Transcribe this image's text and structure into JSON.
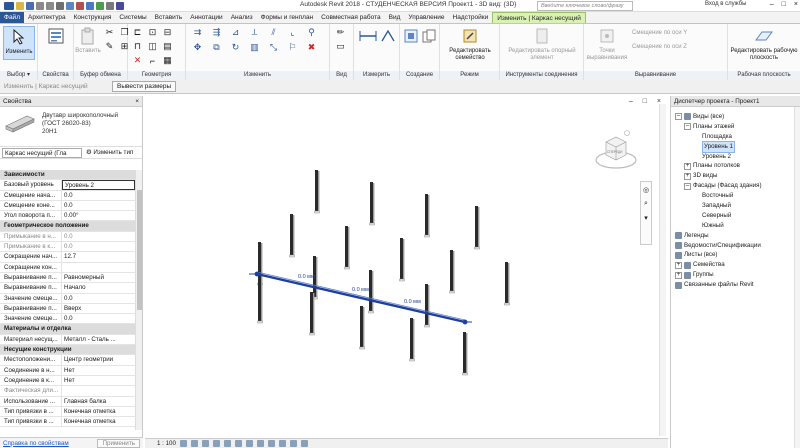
{
  "window": {
    "title": "Autodesk Revit 2018 - СТУДЕНЧЕСКАЯ ВЕРСИЯ    Проект1 - 3D вид: {3D}",
    "search_placeholder": "Введите ключевое слово/фразу",
    "login": "Вход в службы",
    "controls": [
      "–",
      "□",
      "×"
    ]
  },
  "tabs": [
    "Файл",
    "Архитектура",
    "Конструкция",
    "Системы",
    "Вставить",
    "Аннотации",
    "Анализ",
    "Формы и генплан",
    "Совместная работа",
    "Вид",
    "Управление",
    "Надстройки",
    "Изменить | Каркас несущий"
  ],
  "ribbon": {
    "select": {
      "modify": "Изменить",
      "label": "Выбор ▾"
    },
    "properties": {
      "label": "Свойства"
    },
    "clipboard": {
      "paste": "Вставить",
      "label": "Буфер обмена"
    },
    "geometry": {
      "label": "Геометрия"
    },
    "modify": {
      "label": "Изменить"
    },
    "view": {
      "label": "Вид"
    },
    "measure": {
      "label": "Измерить"
    },
    "create": {
      "label": "Создание"
    },
    "mode": {
      "edit_family": "Редактировать семейство",
      "label": "Режим"
    },
    "connection_tools": {
      "edit_element": "Редактировать опорный элемент",
      "label": "Инструменты соединения"
    },
    "justification": {
      "points": "Точки выравнивания",
      "y_offset": "Смещение по оси Y",
      "z_offset": "Смещение по оси Z",
      "label": "Выравнивание"
    },
    "workplane": {
      "edit": "Редактировать рабочую плоскость",
      "label": "Рабочая плоскость"
    }
  },
  "options_bar": {
    "context": "Изменить | Каркас несущий",
    "button": "Вывести размеры"
  },
  "properties": {
    "title": "Свойства",
    "type_name": [
      "Двутавр широкополочный",
      "(ГОСТ 26020-83)",
      "20Н1"
    ],
    "instance_filter": "Каркас несущий (Гла",
    "edit_type": "Изменить тип",
    "rows": [
      {
        "k": "Зависимости",
        "v": "",
        "group": true
      },
      {
        "k": "Базовый уровень",
        "v": "Уровень 2",
        "sel": true
      },
      {
        "k": "Смещение нача...",
        "v": "0.0"
      },
      {
        "k": "Смещение коне...",
        "v": "0.0"
      },
      {
        "k": "Угол поворота п...",
        "v": "0.00°"
      },
      {
        "k": "Геометрическое положение",
        "v": "",
        "group": true
      },
      {
        "k": "Примыкание в н...",
        "v": "0.0",
        "dim": true
      },
      {
        "k": "Примыкание в к...",
        "v": "0.0",
        "dim": true
      },
      {
        "k": "Сокращение нач...",
        "v": "12.7"
      },
      {
        "k": "Сокращение кон...",
        "v": ""
      },
      {
        "k": "Выравнивание п...",
        "v": "Равномерный"
      },
      {
        "k": "Выравнивание п...",
        "v": "Начало"
      },
      {
        "k": "Значение смеще...",
        "v": "0.0"
      },
      {
        "k": "Выравнивание п...",
        "v": "Вверх"
      },
      {
        "k": "Значение смеще...",
        "v": "0.0"
      },
      {
        "k": "Материалы и отделка",
        "v": "",
        "group": true
      },
      {
        "k": "Материал несущ...",
        "v": "Металл - Сталь ..."
      },
      {
        "k": "Несущие конструкции",
        "v": "",
        "group": true
      },
      {
        "k": "Местоположени...",
        "v": "Центр геометрии"
      },
      {
        "k": "Соединение в н...",
        "v": "Нет"
      },
      {
        "k": "Соединение в к...",
        "v": "Нет"
      },
      {
        "k": "Фактическая дли...",
        "v": "",
        "dim": true
      },
      {
        "k": "Использование ...",
        "v": "Главная балка"
      },
      {
        "k": "Тип привязки в ...",
        "v": "Конечная отметка"
      },
      {
        "k": "Тип привязки в ...",
        "v": "Конечная отметка"
      }
    ],
    "help_link": "Справка по свойствам",
    "apply": "Применить"
  },
  "viewport": {
    "dimensions": [
      "0.0 мм",
      "0.0 мм",
      "0.0 мм"
    ],
    "viewcube_front": "СПЕРЕДИ",
    "view_controls": "–  □  ×"
  },
  "statusbar": {
    "scale": "1 : 100"
  },
  "browser": {
    "title": "Диспетчер проекта - Проект1",
    "nodes": [
      {
        "label": "Виды (все)",
        "depth": 0,
        "tog": "–"
      },
      {
        "label": "Планы этажей",
        "depth": 1,
        "tog": "–"
      },
      {
        "label": "Площадка",
        "depth": 2
      },
      {
        "label": "Уровень 1",
        "depth": 2,
        "sel": true
      },
      {
        "label": "Уровень 2",
        "depth": 2
      },
      {
        "label": "Планы потолков",
        "depth": 1,
        "tog": "+"
      },
      {
        "label": "3D виды",
        "depth": 1,
        "tog": "+"
      },
      {
        "label": "Фасады (Фасад здания)",
        "depth": 1,
        "tog": "–"
      },
      {
        "label": "Восточный",
        "depth": 2
      },
      {
        "label": "Западный",
        "depth": 2
      },
      {
        "label": "Северный",
        "depth": 2
      },
      {
        "label": "Южный",
        "depth": 2
      },
      {
        "label": "Легенды",
        "depth": 0
      },
      {
        "label": "Ведомости/Спецификации",
        "depth": 0
      },
      {
        "label": "Листы (все)",
        "depth": 0
      },
      {
        "label": "Семейства",
        "depth": 0,
        "tog": "+"
      },
      {
        "label": "Группы",
        "depth": 0,
        "tog": "+"
      },
      {
        "label": "Связанные файлы Revit",
        "depth": 0
      }
    ]
  },
  "colors": {
    "accent": "#2b5797",
    "active_tab": "#d9f2b4",
    "beam": "#1f3f9c"
  }
}
